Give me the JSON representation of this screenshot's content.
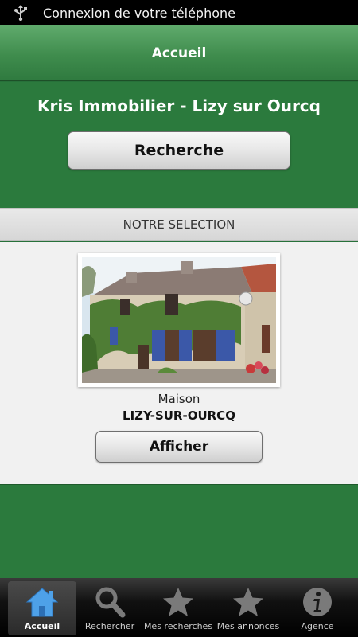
{
  "status_bar": {
    "icon": "usb-icon",
    "text": "Connexion de votre téléphone"
  },
  "title_bar": {
    "title": "Accueil"
  },
  "agency": {
    "name": "Kris Immobilier - Lizy sur Ourcq"
  },
  "search_button": {
    "label": "Recherche"
  },
  "selection": {
    "header": "NOTRE SELECTION"
  },
  "listing": {
    "photo": "house-photo",
    "type": "Maison",
    "city": "LIZY-SUR-OURCQ",
    "show_label": "Afficher"
  },
  "tabs": [
    {
      "label": "Accueil",
      "icon": "home-icon",
      "active": true
    },
    {
      "label": "Rechercher",
      "icon": "magnifier-icon",
      "active": false
    },
    {
      "label": "Mes recherches",
      "icon": "star-icon",
      "active": false
    },
    {
      "label": "Mes annonces",
      "icon": "star-icon",
      "active": false
    },
    {
      "label": "Agence",
      "icon": "info-icon",
      "active": false
    }
  ],
  "colors": {
    "primary_green": "#2b7a3d",
    "title_green": "#4a9958",
    "tab_active": "#4ea1e8"
  }
}
